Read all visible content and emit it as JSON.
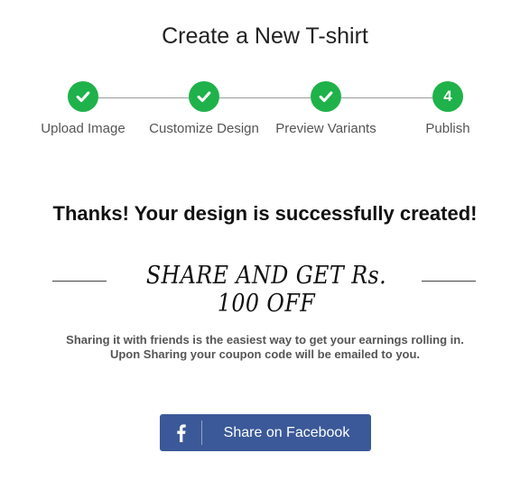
{
  "page": {
    "title": "Create a New T-shirt"
  },
  "stepper": {
    "steps": [
      {
        "label": "Upload Image",
        "status": "completed",
        "icon": "check-icon"
      },
      {
        "label": "Customize Design",
        "status": "completed",
        "icon": "check-icon"
      },
      {
        "label": "Preview Variants",
        "status": "completed",
        "icon": "check-icon"
      },
      {
        "label": "Publish",
        "status": "current",
        "number": "4"
      }
    ],
    "accent_color": "#1fb24a"
  },
  "main": {
    "thanks_message": "Thanks! Your design is successfully created!",
    "share_heading": "SHARE AND GET Rs. 100 OFF",
    "description_line1": "Sharing it with friends is the easiest way to get your earnings rolling in.",
    "description_line2": "Upon Sharing your coupon code will be emailed to you."
  },
  "share_button": {
    "label": "Share on Facebook",
    "icon": "facebook-icon",
    "color": "#3b5998"
  }
}
